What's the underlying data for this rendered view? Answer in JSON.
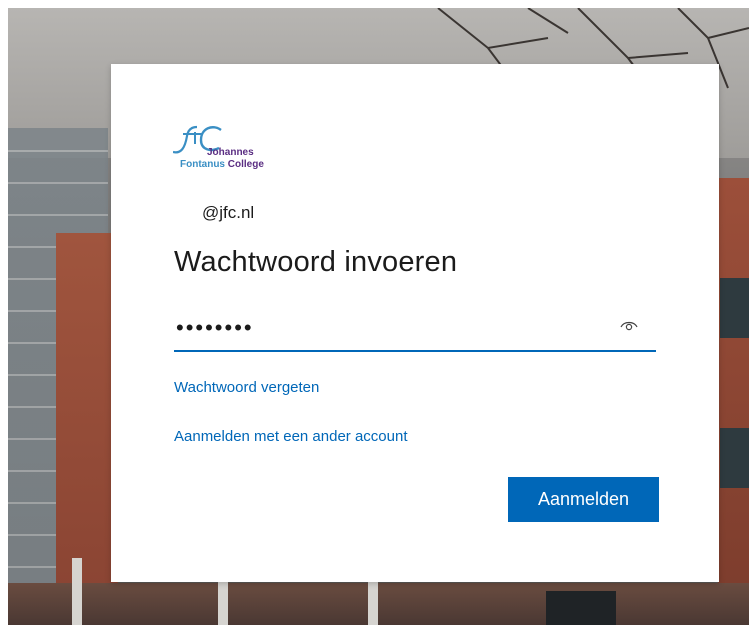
{
  "background": {
    "description_colors": {
      "brick": "#9c4f3a",
      "sky": "#b7b5b2"
    }
  },
  "card": {
    "logo": {
      "line1": "Johannes",
      "line2a": "Fontanus",
      "line2b": "College",
      "icon": "jfc-logo-icon"
    },
    "user_id": "@jfc.nl",
    "title": "Wachtwoord invoeren",
    "password_field": {
      "value": "••••••••",
      "reveal_icon": "eye-icon"
    },
    "links": {
      "forgot": "Wachtwoord vergeten",
      "other_account": "Aanmelden met een ander account"
    },
    "signin_button": "Aanmelden"
  },
  "colors": {
    "accent": "#0067b8",
    "text": "#1b1b1b",
    "logo_purple": "#5a2d82",
    "logo_blue": "#3a8fc4"
  }
}
